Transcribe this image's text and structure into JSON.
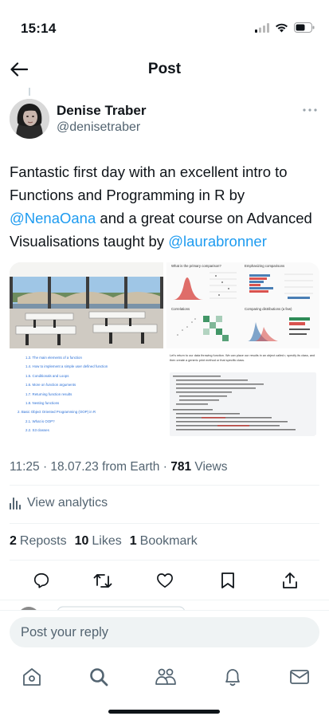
{
  "status_bar": {
    "time": "15:14"
  },
  "header": {
    "title": "Post"
  },
  "author": {
    "name": "Denise Traber",
    "handle": "@denisetraber"
  },
  "tweet": {
    "text_1": "Fantastic first day with an excellent intro to Functions and Programming in R by ",
    "mention_1": "@NenaOana",
    "text_2": " and a great course on Advanced Visualisations taught by ",
    "mention_2": "@laurabronner"
  },
  "media": {
    "chart_panels": [
      "What is the primary comparison?",
      "Emphasizing comparisons",
      "Correlations",
      "Comparing distributions (a few)"
    ],
    "toc_items": [
      "1.3. The main elements of a function",
      "1.4. How to implement a simple user defined function",
      "1.5. Conditionals and Loops",
      "1.6. More on function arguments",
      "1.7. Returning function results",
      "1.8. Nesting functions",
      "2. Basic Object Oriented Programming (OOP) in R",
      "2.1. What is OOP?",
      "2.2. S3 classes"
    ],
    "code_intro": "Let's return to our data throwing function. We can place our results in an object called r, specify its class, and then create a generic print method or that specific class."
  },
  "meta": {
    "time": "11:25",
    "date": "18.07.23",
    "source": "from Earth",
    "views_count": "781",
    "views_label": "Views"
  },
  "analytics": {
    "label": "View analytics"
  },
  "stats": {
    "reposts_count": "2",
    "reposts_label": "Reposts",
    "likes_count": "10",
    "likes_label": "Likes",
    "bookmarks_count": "1",
    "bookmarks_label": "Bookmark"
  },
  "reply": {
    "placeholder": "Post your reply"
  },
  "icons": {
    "back": "arrow-left-icon",
    "more": "more-horizontal-icon",
    "analytics": "bar-chart-icon",
    "reply": "comment-icon",
    "repost": "repost-icon",
    "like": "heart-icon",
    "bookmark": "bookmark-icon",
    "share": "share-icon",
    "tabs": [
      "home-icon",
      "search-icon",
      "communities-icon",
      "bell-icon",
      "mail-icon"
    ]
  },
  "colors": {
    "accent": "#1d9bf0",
    "text": "#0f1419",
    "secondary": "#536471"
  }
}
